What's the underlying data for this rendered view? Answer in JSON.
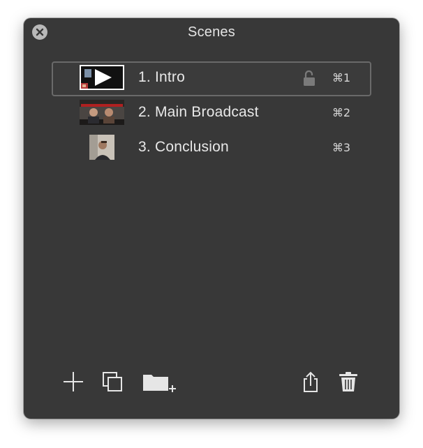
{
  "window": {
    "title": "Scenes"
  },
  "scenes": [
    {
      "label": "1. Intro",
      "shortcut": "⌘1",
      "selected": true,
      "locked": false,
      "thumbnail": "play-thumbnail"
    },
    {
      "label": "2. Main Broadcast",
      "shortcut": "⌘2",
      "selected": false,
      "thumbnail": "broadcast-thumbnail"
    },
    {
      "label": "3. Conclusion",
      "shortcut": "⌘3",
      "selected": false,
      "thumbnail": "person-thumbnail"
    }
  ],
  "toolbar": {
    "left": [
      "add-icon",
      "duplicate-icon",
      "new-folder-icon"
    ],
    "right": [
      "share-icon",
      "trash-icon"
    ]
  },
  "colors": {
    "panel_bg": "#383838",
    "text": "#e8e8e8",
    "selection_border": "#6a6a6a",
    "icon": "#e6e6e6"
  }
}
